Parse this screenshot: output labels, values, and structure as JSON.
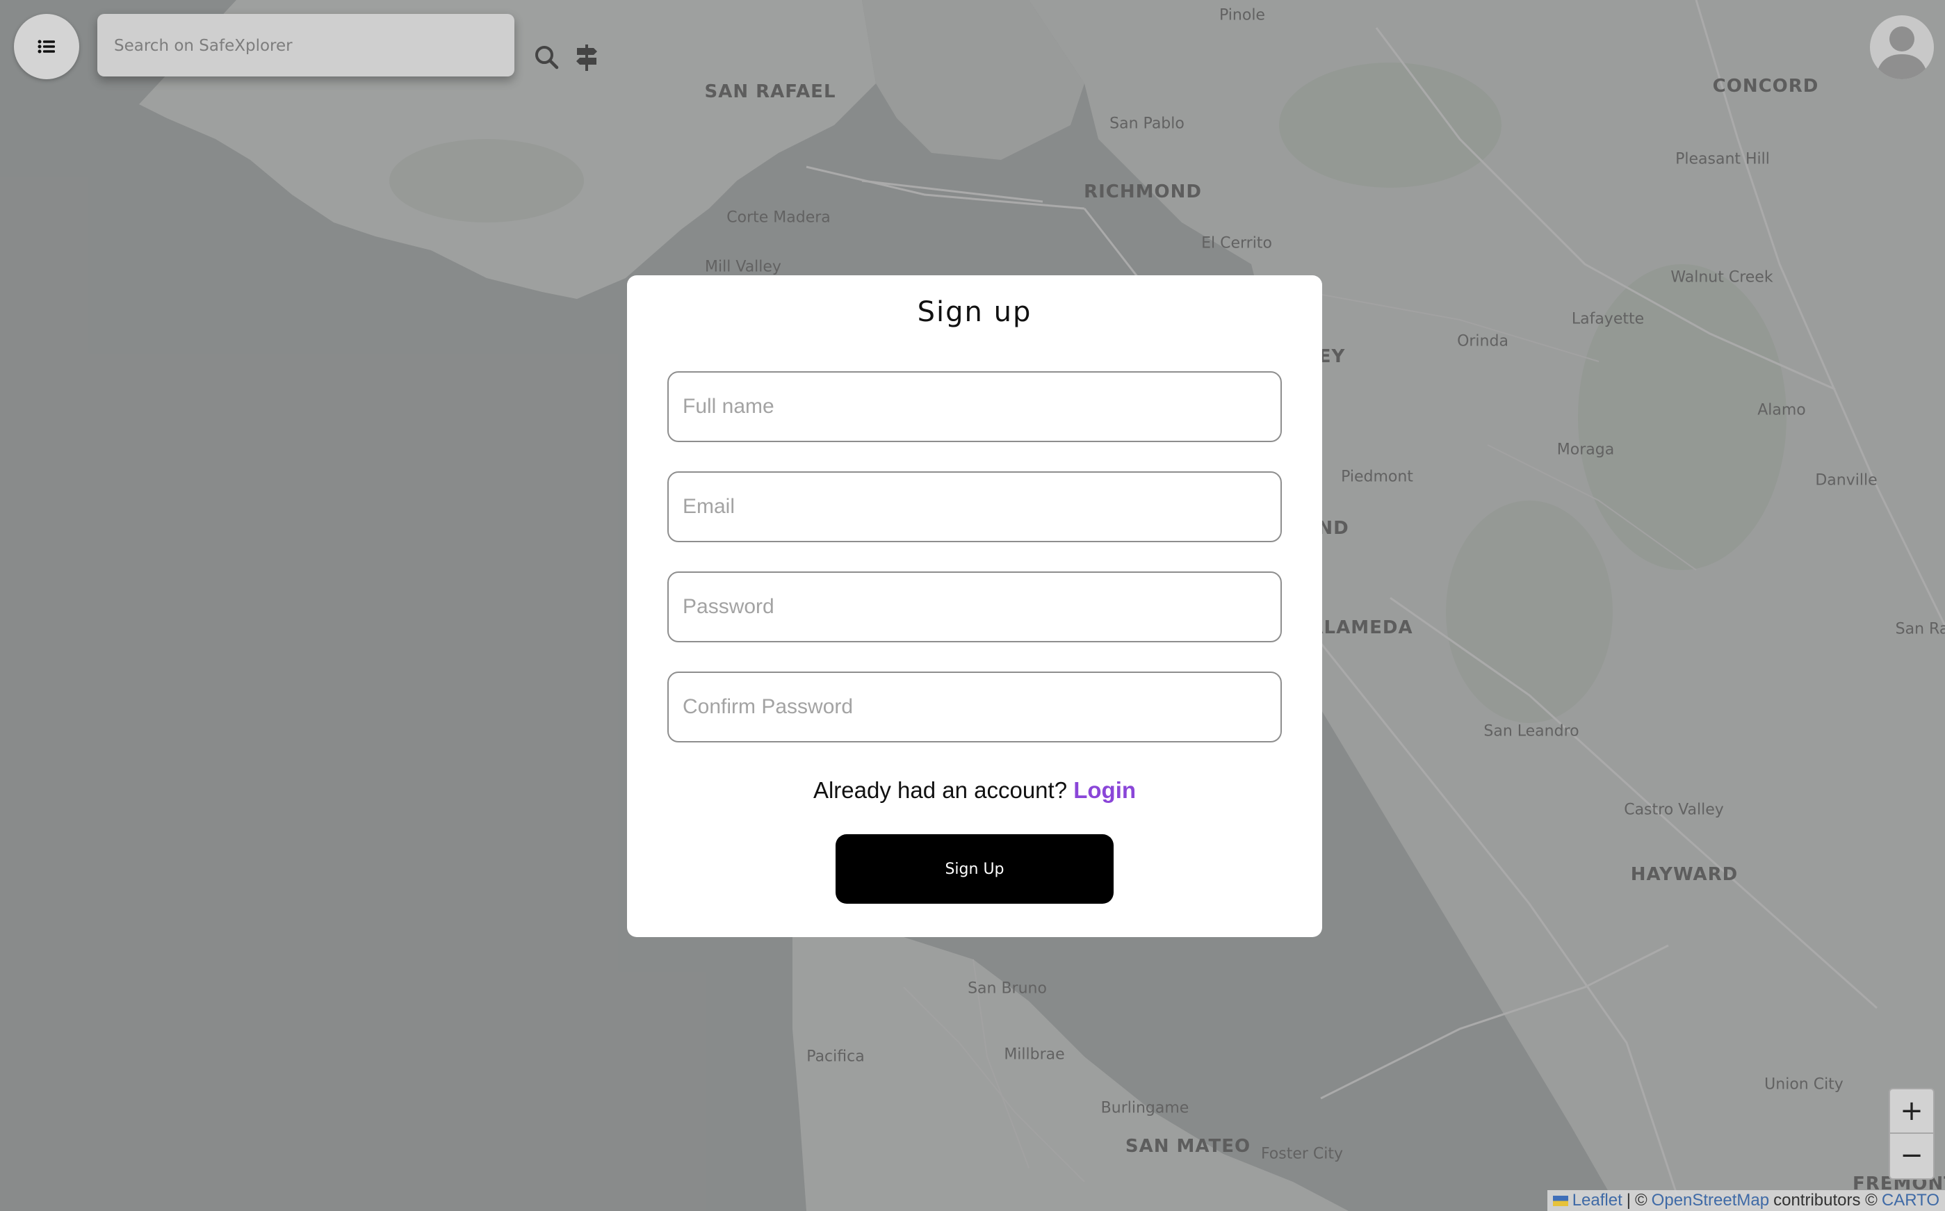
{
  "app": {
    "name": "SafeXplorer"
  },
  "search": {
    "placeholder": "Search on SafeXplorer",
    "search_icon": "search-icon",
    "filter_icon": "signpost-icon"
  },
  "menu": {
    "icon": "list-icon"
  },
  "user": {
    "icon": "user-avatar-icon"
  },
  "map": {
    "labels": [
      {
        "text": "Pinole"
      },
      {
        "text": "SAN RAFAEL"
      },
      {
        "text": "San Pablo"
      },
      {
        "text": "CONCORD"
      },
      {
        "text": "Pleasant Hill"
      },
      {
        "text": "RICHMOND"
      },
      {
        "text": "Corte Madera"
      },
      {
        "text": "El Cerrito"
      },
      {
        "text": "Mill Valley"
      },
      {
        "text": "Walnut Creek"
      },
      {
        "text": "Lafayette"
      },
      {
        "text": "Orinda"
      },
      {
        "text": "EY"
      },
      {
        "text": "Alamo"
      },
      {
        "text": "Moraga"
      },
      {
        "text": "Piedmont"
      },
      {
        "text": "Danville"
      },
      {
        "text": "ND"
      },
      {
        "text": "ALAMEDA"
      },
      {
        "text": "San Ra"
      },
      {
        "text": "San Leandro"
      },
      {
        "text": "Castro Valley"
      },
      {
        "text": "HAYWARD"
      },
      {
        "text": "San Bruno"
      },
      {
        "text": "Pacifica"
      },
      {
        "text": "Millbrae"
      },
      {
        "text": "Union City"
      },
      {
        "text": "Burlingame"
      },
      {
        "text": "SAN MATEO"
      },
      {
        "text": "Foster City"
      },
      {
        "text": "FREMONT"
      }
    ],
    "zoom_in": "+",
    "zoom_out": "−"
  },
  "signup_form": {
    "title": "Sign up",
    "fields": {
      "full_name": {
        "placeholder": "Full name",
        "value": ""
      },
      "email": {
        "placeholder": "Email",
        "value": ""
      },
      "password": {
        "placeholder": "Password",
        "value": ""
      },
      "confirm_password": {
        "placeholder": "Confirm Password",
        "value": ""
      }
    },
    "account_prompt": "Already had an account?",
    "login_link": "Login",
    "submit_label": "Sign Up",
    "colors": {
      "link": "#8a46d8",
      "button_bg": "#000000",
      "button_text": "#ffffff"
    }
  },
  "attribution": {
    "leaflet": "Leaflet",
    "sep1": "|",
    "copyright": "©",
    "osm": "OpenStreetMap",
    "contributors": "contributors ©",
    "carto": "CARTO"
  }
}
